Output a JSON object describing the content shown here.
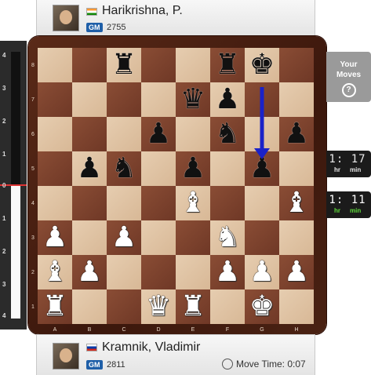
{
  "top_player": {
    "name": "Harikrishna, P.",
    "title": "GM",
    "rating": "2755",
    "flag": "india-flag"
  },
  "bottom_player": {
    "name": "Kramnik, Vladimir",
    "title": "GM",
    "rating": "2811",
    "flag": "russia-flag",
    "move_time_label": "Move Time: 0:07"
  },
  "your_moves": {
    "line1": "Your",
    "line2": "Moves",
    "help": "?"
  },
  "clocks": {
    "top": {
      "time": "1: 17",
      "hr": "hr",
      "min": "min"
    },
    "bottom": {
      "time": "1: 11",
      "hr": "hr",
      "min": "min"
    }
  },
  "eval_bar": {
    "labels_top": [
      "4",
      "3",
      "2",
      "1",
      "0"
    ],
    "labels_bottom": [
      "1",
      "2",
      "3",
      "4"
    ],
    "white_fraction": 0.45
  },
  "board": {
    "ranks": [
      "8",
      "7",
      "6",
      "5",
      "4",
      "3",
      "2",
      "1"
    ],
    "files": [
      "A",
      "B",
      "C",
      "D",
      "E",
      "F",
      "G",
      "H"
    ],
    "pieces": [
      {
        "sq": "c8",
        "p": "♜",
        "c": "b"
      },
      {
        "sq": "f8",
        "p": "♜",
        "c": "b"
      },
      {
        "sq": "g8",
        "p": "♚",
        "c": "b"
      },
      {
        "sq": "e7",
        "p": "♛",
        "c": "b"
      },
      {
        "sq": "f7",
        "p": "♟",
        "c": "b"
      },
      {
        "sq": "d6",
        "p": "♟",
        "c": "b"
      },
      {
        "sq": "f6",
        "p": "♞",
        "c": "b"
      },
      {
        "sq": "h6",
        "p": "♟",
        "c": "b"
      },
      {
        "sq": "b5",
        "p": "♟",
        "c": "b"
      },
      {
        "sq": "c5",
        "p": "♞",
        "c": "b"
      },
      {
        "sq": "e5",
        "p": "♟",
        "c": "b"
      },
      {
        "sq": "g5",
        "p": "♟",
        "c": "b"
      },
      {
        "sq": "e4",
        "p": "♝",
        "c": "w"
      },
      {
        "sq": "h4",
        "p": "♝",
        "c": "w"
      },
      {
        "sq": "a3",
        "p": "♟",
        "c": "w"
      },
      {
        "sq": "c3",
        "p": "♟",
        "c": "w"
      },
      {
        "sq": "f3",
        "p": "♞",
        "c": "w"
      },
      {
        "sq": "a2",
        "p": "♝",
        "c": "w"
      },
      {
        "sq": "b2",
        "p": "♟",
        "c": "w"
      },
      {
        "sq": "f2",
        "p": "♟",
        "c": "w"
      },
      {
        "sq": "g2",
        "p": "♟",
        "c": "w"
      },
      {
        "sq": "h2",
        "p": "♟",
        "c": "w"
      },
      {
        "sq": "a1",
        "p": "♜",
        "c": "w"
      },
      {
        "sq": "d1",
        "p": "♛",
        "c": "w"
      },
      {
        "sq": "e1",
        "p": "♜",
        "c": "w"
      },
      {
        "sq": "g1",
        "p": "♚",
        "c": "w"
      }
    ],
    "arrow": {
      "from": "g7",
      "to": "g5",
      "color": "#1a22c8"
    }
  }
}
